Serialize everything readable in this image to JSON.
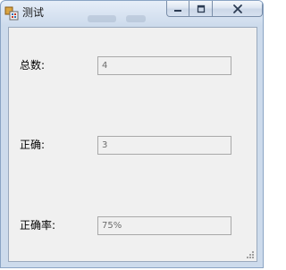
{
  "window": {
    "title": "测试"
  },
  "title_buttons": {
    "minimize_icon": "minimize-icon",
    "maximize_icon": "maximize-icon",
    "close_icon": "close-icon"
  },
  "form": {
    "total": {
      "label": "总数:",
      "value": "4"
    },
    "correct": {
      "label": "正确:",
      "value": "3"
    },
    "accuracy": {
      "label": "正确率:",
      "value": "75%"
    }
  },
  "colors": {
    "title_bar": "#cddbec",
    "client_background": "#f0f0f0",
    "field_border": "#a9a9a9"
  }
}
